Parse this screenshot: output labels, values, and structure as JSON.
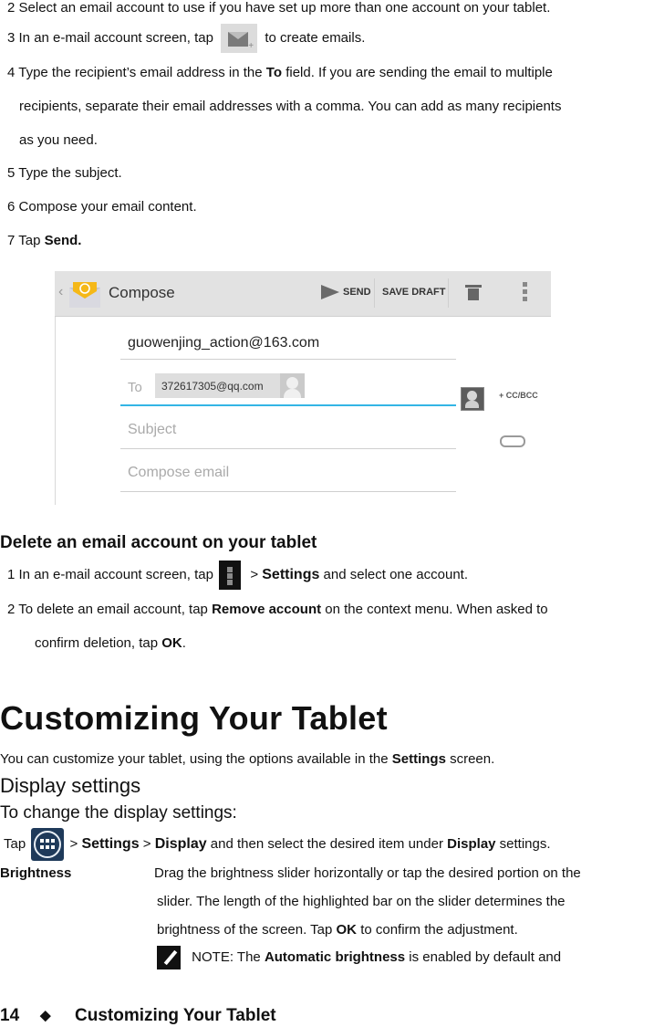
{
  "steps_compose": [
    {
      "num": "2",
      "text": "Select an email account to use if you have set up more than one account on your tablet."
    },
    {
      "num": "3",
      "pre": "In an e-mail account screen, tap",
      "icon": "compose-email-icon",
      "post": "to create emails."
    },
    {
      "num": "4",
      "pre": "Type the recipient’s email address in the",
      "bold": "To",
      "post": "field. If you are sending the email to multiple",
      "cont1": "recipients, separate their email addresses with a comma. You can add as many recipients",
      "cont2": "as you need."
    },
    {
      "num": "5",
      "text": "Type the subject."
    },
    {
      "num": "6",
      "text": "Compose your email content."
    },
    {
      "num": "7",
      "pre": "Tap",
      "bold": "Send."
    }
  ],
  "compose_screen": {
    "back_icon": "back-chevron-icon",
    "app_icon": "email-app-icon",
    "title": "Compose",
    "send_label": "SEND",
    "save_draft_label": "SAVE DRAFT",
    "delete_icon": "trash-icon",
    "overflow_icon": "overflow-menu-icon",
    "from": "guowenjing_action@163.com",
    "to_label": "To",
    "to_recipient": "372617305@qq.com",
    "cc_bcc_label": "+ CC/BCC",
    "subject_placeholder": "Subject",
    "body_placeholder": "Compose email",
    "accent_color": "#33b5e5"
  },
  "delete_section": {
    "heading": "Delete an email account on your tablet",
    "step1": {
      "num": "1",
      "pre": "In an e-mail account screen, tap",
      "icon": "overflow-menu-icon",
      "gt": ">",
      "bold": "Settings",
      "post": "and select one account."
    },
    "step2": {
      "num": "2",
      "pre": "To delete an email account, tap",
      "bold": "Remove account",
      "post": "on the context menu. When asked to",
      "cont_pre": "confirm deletion, tap",
      "cont_bold": "OK",
      "cont_post": "."
    }
  },
  "customize": {
    "title": "Customizing Your Tablet",
    "intro_pre": "You can customize your tablet, using the options available in the",
    "intro_bold": "Settings",
    "intro_post": "screen.",
    "display_heading": "Display settings",
    "change_heading": "To change the display settings:",
    "tap_line": {
      "pre": "Tap",
      "icon": "apps-icon",
      "gt1": ">",
      "settings": "Settings",
      "gt2": ">",
      "display": "Display",
      "mid": "and then select the desired item under",
      "display2": "Display",
      "post": "settings."
    },
    "brightness_label": "Brightness",
    "brightness_desc1": "Drag the brightness slider horizontally or tap the desired portion on the",
    "brightness_desc2": "slider. The  length of the highlighted bar on the slider determines the",
    "brightness_desc3_pre": "brightness of the screen. Tap",
    "brightness_desc3_bold": "OK",
    "brightness_desc3_post": "to confirm the adjustment.",
    "note_pre": "NOTE: The",
    "note_bold": "Automatic brightness",
    "note_post": "is enabled by default and"
  },
  "footer": {
    "page_number": "14",
    "separator": "◆",
    "section_title": "Customizing Your Tablet"
  }
}
